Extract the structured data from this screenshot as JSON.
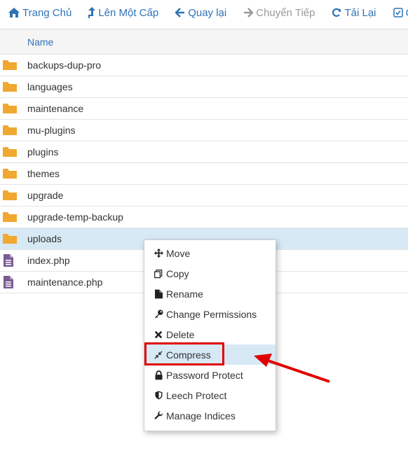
{
  "toolbar": {
    "home_label": "Trang Chủ",
    "up_label": "Lên Một Cấp",
    "back_label": "Quay lại",
    "forward_label": "Chuyển Tiếp",
    "reload_label": "Tải Lại",
    "select_label": "Ch"
  },
  "table": {
    "header_name": "Name",
    "rows": [
      {
        "name": "backups-dup-pro",
        "type": "folder"
      },
      {
        "name": "languages",
        "type": "folder"
      },
      {
        "name": "maintenance",
        "type": "folder"
      },
      {
        "name": "mu-plugins",
        "type": "folder"
      },
      {
        "name": "plugins",
        "type": "folder"
      },
      {
        "name": "themes",
        "type": "folder"
      },
      {
        "name": "upgrade",
        "type": "folder"
      },
      {
        "name": "upgrade-temp-backup",
        "type": "folder"
      },
      {
        "name": "uploads",
        "type": "folder",
        "selected": true
      },
      {
        "name": "index.php",
        "type": "file"
      },
      {
        "name": "maintenance.php",
        "type": "file"
      }
    ]
  },
  "context_menu": {
    "items": [
      {
        "label": "Move",
        "icon": "move-icon"
      },
      {
        "label": "Copy",
        "icon": "copy-icon"
      },
      {
        "label": "Rename",
        "icon": "file-icon"
      },
      {
        "label": "Change Permissions",
        "icon": "key-icon"
      },
      {
        "label": "Delete",
        "icon": "close-icon"
      },
      {
        "label": "Compress",
        "icon": "compress-icon",
        "highlighted": true
      },
      {
        "label": "Password Protect",
        "icon": "lock-icon"
      },
      {
        "label": "Leech Protect",
        "icon": "shield-icon"
      },
      {
        "label": "Manage Indices",
        "icon": "wrench-icon"
      }
    ]
  },
  "colors": {
    "link": "#2f73b6",
    "folder": "#f0a830",
    "file": "#7a5c93",
    "selected_row": "#d7e9f5",
    "annotation": "#e00000"
  }
}
